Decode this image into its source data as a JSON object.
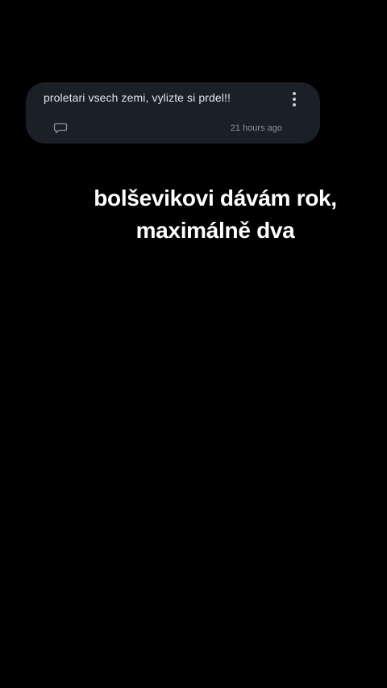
{
  "comment": {
    "text": "proletari vsech zemi, vylizte si prdel!!",
    "timestamp": "21 hours ago",
    "icons": {
      "reply": "speech-bubble-icon",
      "more": "more-vertical-icon"
    }
  },
  "caption": {
    "line1": "bolševikovi dávám rok,",
    "line2": "maximálně dva"
  },
  "colors": {
    "background": "#000000",
    "card": "#1b1f26",
    "comment_text": "#dfe3ea",
    "timestamp": "#8c929b",
    "caption": "#ffffff"
  }
}
